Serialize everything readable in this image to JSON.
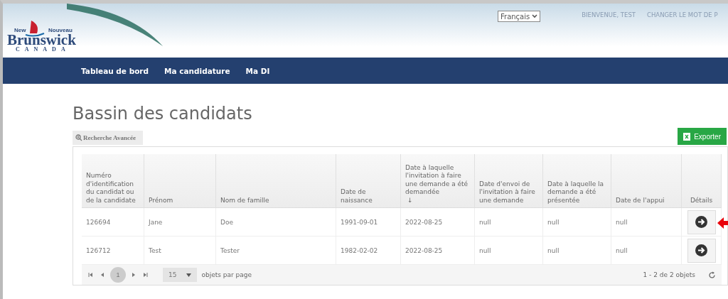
{
  "logo": {
    "top_left": "New",
    "top_right": "Nouveau",
    "name": "Brunswick",
    "country": "CANADA"
  },
  "language": {
    "value": "Français"
  },
  "user_links": [
    "BIENVENUE, TEST",
    "CHANGER LE MOT DE P"
  ],
  "nav": [
    "Tableau de bord",
    "Ma candidature",
    "Ma DI"
  ],
  "title": "Bassin des candidats",
  "advanced_search": "Recherche Avancée",
  "export": "Exporter",
  "table": {
    "columns": [
      {
        "label": "Numéro d'identification du candidat ou de la candidate"
      },
      {
        "label": "Prénom"
      },
      {
        "label": "Nom de famille"
      },
      {
        "label": "Date de naissance"
      },
      {
        "label": "Date à laquelle l'invitation à faire une demande a été demandée",
        "sort_mark": "↓"
      },
      {
        "label": "Date d'envoi de l'invitation à faire une demande"
      },
      {
        "label": "Date à laquelle la demande a été présentée"
      },
      {
        "label": "Date de l'appui"
      },
      {
        "label": "Détails"
      }
    ],
    "rows": [
      {
        "cells": [
          "126694",
          "Jane",
          "Doe",
          "1991-09-01",
          "2022-08-25",
          "null",
          "null",
          "null"
        ],
        "pointed": true
      },
      {
        "cells": [
          "126712",
          "Test",
          "Tester",
          "1982-02-02",
          "2022-08-25",
          "null",
          "null",
          "null"
        ],
        "pointed": false
      }
    ]
  },
  "pager": {
    "pages": [
      {
        "label": "1",
        "selected": true
      }
    ],
    "page_size": "15",
    "per_page_label": "objets par page",
    "summary": "1 - 2 de 2 objets"
  }
}
